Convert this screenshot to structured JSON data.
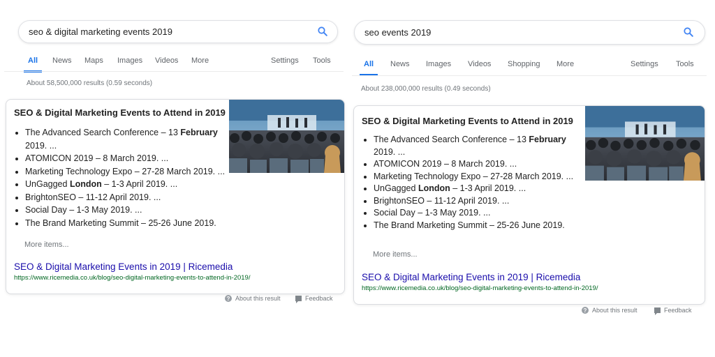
{
  "left": {
    "query": "seo & digital marketing events 2019",
    "tabs": [
      "All",
      "News",
      "Maps",
      "Images",
      "Videos",
      "More",
      "Settings",
      "Tools"
    ],
    "result_stats": "About 58,500,000 results (0.59 seconds)"
  },
  "right": {
    "query": "seo events 2019",
    "tabs": [
      "All",
      "News",
      "Images",
      "Videos",
      "Shopping",
      "More",
      "Settings",
      "Tools"
    ],
    "result_stats": "About 238,000,000 results (0.49 seconds)"
  },
  "card": {
    "title": "SEO & Digital Marketing Events to Attend in 2019",
    "items": [
      [
        {
          "t": "The Advanced Search Conference – 13 "
        },
        {
          "t": "February",
          "b": true
        },
        {
          "t": " 2019. ..."
        }
      ],
      [
        {
          "t": "ATOMICON 2019 – 8 March 2019. ..."
        }
      ],
      [
        {
          "t": "Marketing Technology Expo – 27-28 March 2019. ..."
        }
      ],
      [
        {
          "t": "UnGagged "
        },
        {
          "t": "London",
          "b": true
        },
        {
          "t": " – 1-3 April 2019. ..."
        }
      ],
      [
        {
          "t": "BrightonSEO – 11-12 April 2019. ..."
        }
      ],
      [
        {
          "t": "Social Day – 1-3 May 2019. ..."
        }
      ],
      [
        {
          "t": "The Brand Marketing Summit – 25-26 June 2019."
        }
      ]
    ],
    "more_items": "More items...",
    "link_title": "SEO & Digital Marketing Events in 2019 | Ricemedia",
    "url": "https://www.ricemedia.co.uk/blog/seo-digital-marketing-events-to-attend-in-2019/"
  },
  "footer": {
    "about": "About this result",
    "feedback": "Feedback"
  },
  "colors": {
    "accent": "#1a73e8",
    "link": "#1a0dab",
    "url": "#006621",
    "muted": "#70757a"
  },
  "icons": {
    "search": "search-icon",
    "about": "help-circle-icon",
    "feedback": "feedback-icon",
    "photo": "conference-audience-photo"
  }
}
